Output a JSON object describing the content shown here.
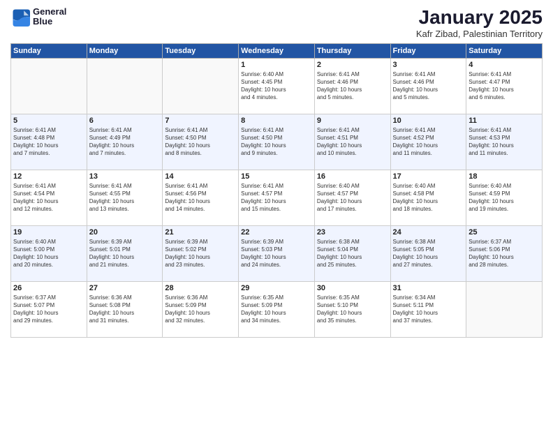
{
  "logo": {
    "line1": "General",
    "line2": "Blue"
  },
  "title": "January 2025",
  "subtitle": "Kafr Zibad, Palestinian Territory",
  "weekdays": [
    "Sunday",
    "Monday",
    "Tuesday",
    "Wednesday",
    "Thursday",
    "Friday",
    "Saturday"
  ],
  "weeks": [
    [
      {
        "day": "",
        "info": ""
      },
      {
        "day": "",
        "info": ""
      },
      {
        "day": "",
        "info": ""
      },
      {
        "day": "1",
        "info": "Sunrise: 6:40 AM\nSunset: 4:45 PM\nDaylight: 10 hours\nand 4 minutes."
      },
      {
        "day": "2",
        "info": "Sunrise: 6:41 AM\nSunset: 4:46 PM\nDaylight: 10 hours\nand 5 minutes."
      },
      {
        "day": "3",
        "info": "Sunrise: 6:41 AM\nSunset: 4:46 PM\nDaylight: 10 hours\nand 5 minutes."
      },
      {
        "day": "4",
        "info": "Sunrise: 6:41 AM\nSunset: 4:47 PM\nDaylight: 10 hours\nand 6 minutes."
      }
    ],
    [
      {
        "day": "5",
        "info": "Sunrise: 6:41 AM\nSunset: 4:48 PM\nDaylight: 10 hours\nand 7 minutes."
      },
      {
        "day": "6",
        "info": "Sunrise: 6:41 AM\nSunset: 4:49 PM\nDaylight: 10 hours\nand 7 minutes."
      },
      {
        "day": "7",
        "info": "Sunrise: 6:41 AM\nSunset: 4:50 PM\nDaylight: 10 hours\nand 8 minutes."
      },
      {
        "day": "8",
        "info": "Sunrise: 6:41 AM\nSunset: 4:50 PM\nDaylight: 10 hours\nand 9 minutes."
      },
      {
        "day": "9",
        "info": "Sunrise: 6:41 AM\nSunset: 4:51 PM\nDaylight: 10 hours\nand 10 minutes."
      },
      {
        "day": "10",
        "info": "Sunrise: 6:41 AM\nSunset: 4:52 PM\nDaylight: 10 hours\nand 11 minutes."
      },
      {
        "day": "11",
        "info": "Sunrise: 6:41 AM\nSunset: 4:53 PM\nDaylight: 10 hours\nand 11 minutes."
      }
    ],
    [
      {
        "day": "12",
        "info": "Sunrise: 6:41 AM\nSunset: 4:54 PM\nDaylight: 10 hours\nand 12 minutes."
      },
      {
        "day": "13",
        "info": "Sunrise: 6:41 AM\nSunset: 4:55 PM\nDaylight: 10 hours\nand 13 minutes."
      },
      {
        "day": "14",
        "info": "Sunrise: 6:41 AM\nSunset: 4:56 PM\nDaylight: 10 hours\nand 14 minutes."
      },
      {
        "day": "15",
        "info": "Sunrise: 6:41 AM\nSunset: 4:57 PM\nDaylight: 10 hours\nand 15 minutes."
      },
      {
        "day": "16",
        "info": "Sunrise: 6:40 AM\nSunset: 4:57 PM\nDaylight: 10 hours\nand 17 minutes."
      },
      {
        "day": "17",
        "info": "Sunrise: 6:40 AM\nSunset: 4:58 PM\nDaylight: 10 hours\nand 18 minutes."
      },
      {
        "day": "18",
        "info": "Sunrise: 6:40 AM\nSunset: 4:59 PM\nDaylight: 10 hours\nand 19 minutes."
      }
    ],
    [
      {
        "day": "19",
        "info": "Sunrise: 6:40 AM\nSunset: 5:00 PM\nDaylight: 10 hours\nand 20 minutes."
      },
      {
        "day": "20",
        "info": "Sunrise: 6:39 AM\nSunset: 5:01 PM\nDaylight: 10 hours\nand 21 minutes."
      },
      {
        "day": "21",
        "info": "Sunrise: 6:39 AM\nSunset: 5:02 PM\nDaylight: 10 hours\nand 23 minutes."
      },
      {
        "day": "22",
        "info": "Sunrise: 6:39 AM\nSunset: 5:03 PM\nDaylight: 10 hours\nand 24 minutes."
      },
      {
        "day": "23",
        "info": "Sunrise: 6:38 AM\nSunset: 5:04 PM\nDaylight: 10 hours\nand 25 minutes."
      },
      {
        "day": "24",
        "info": "Sunrise: 6:38 AM\nSunset: 5:05 PM\nDaylight: 10 hours\nand 27 minutes."
      },
      {
        "day": "25",
        "info": "Sunrise: 6:37 AM\nSunset: 5:06 PM\nDaylight: 10 hours\nand 28 minutes."
      }
    ],
    [
      {
        "day": "26",
        "info": "Sunrise: 6:37 AM\nSunset: 5:07 PM\nDaylight: 10 hours\nand 29 minutes."
      },
      {
        "day": "27",
        "info": "Sunrise: 6:36 AM\nSunset: 5:08 PM\nDaylight: 10 hours\nand 31 minutes."
      },
      {
        "day": "28",
        "info": "Sunrise: 6:36 AM\nSunset: 5:09 PM\nDaylight: 10 hours\nand 32 minutes."
      },
      {
        "day": "29",
        "info": "Sunrise: 6:35 AM\nSunset: 5:09 PM\nDaylight: 10 hours\nand 34 minutes."
      },
      {
        "day": "30",
        "info": "Sunrise: 6:35 AM\nSunset: 5:10 PM\nDaylight: 10 hours\nand 35 minutes."
      },
      {
        "day": "31",
        "info": "Sunrise: 6:34 AM\nSunset: 5:11 PM\nDaylight: 10 hours\nand 37 minutes."
      },
      {
        "day": "",
        "info": ""
      }
    ]
  ]
}
